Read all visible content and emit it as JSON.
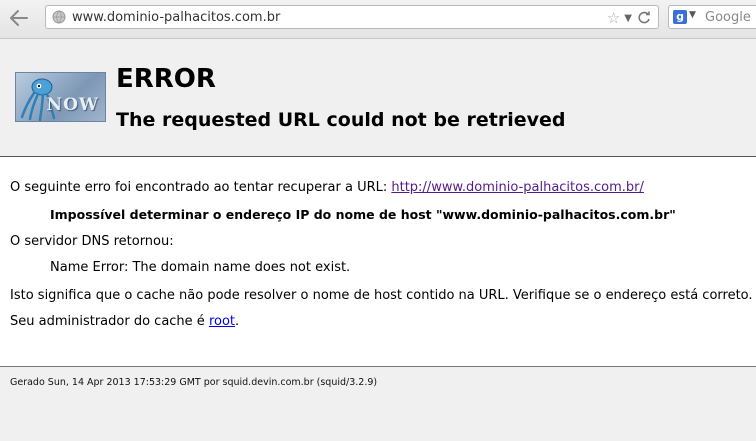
{
  "browser": {
    "url": "www.dominio-palhacitos.com.br",
    "search_placeholder": "Google",
    "search_engine_letter": "g"
  },
  "header": {
    "logo_text": "NOW",
    "title": "ERROR",
    "subtitle": "The requested URL could not be retrieved"
  },
  "body": {
    "line1_text": "O seguinte erro foi encontrado ao tentar recuperar a URL: ",
    "line1_link": "http://www.dominio-palhacitos.com.br/",
    "line2": "Impossível determinar o endereço IP do nome de host \"www.dominio-palhacitos.com.br\"",
    "line3": "O servidor DNS retornou:",
    "line4": "Name Error: The domain name does not exist.",
    "line5": "Isto significa que o cache não pode resolver o nome de host contido na URL. Verifique se o endereço está correto.",
    "line6_text": "Seu administrador do cache é ",
    "line6_link": "root",
    "line6_after": "."
  },
  "footer": {
    "text": "Gerado Sun, 14 Apr 2013 17:53:29 GMT por squid.devin.com.br (squid/3.2.9)"
  }
}
